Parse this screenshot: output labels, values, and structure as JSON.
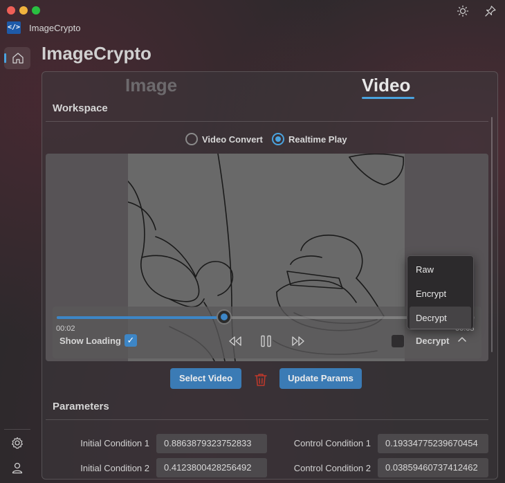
{
  "app": {
    "name": "ImageCrypto",
    "logo_text": "</>"
  },
  "page": {
    "title": "ImageCrypto"
  },
  "tabs": [
    {
      "label": "Image",
      "active": false
    },
    {
      "label": "Video",
      "active": true
    }
  ],
  "workspace": {
    "title": "Workspace",
    "modes": [
      {
        "label": "Video Convert",
        "checked": false
      },
      {
        "label": "Realtime Play",
        "checked": true
      }
    ]
  },
  "player": {
    "current_time": "00:02",
    "duration": "00:05",
    "progress": 0.4,
    "show_loading_label": "Show Loading",
    "show_loading_checked": true,
    "mode_value": "Decrypt",
    "controls": [
      "rewind-icon",
      "pause-icon",
      "fast-forward-icon"
    ]
  },
  "mode_menu": {
    "items": [
      "Raw",
      "Encrypt",
      "Decrypt"
    ],
    "selected": "Decrypt"
  },
  "actions": {
    "select_video": "Select Video",
    "update_params": "Update Params"
  },
  "parameters": {
    "title": "Parameters",
    "fields": [
      {
        "label": "Initial Condition 1",
        "value": "0.8863879323752833"
      },
      {
        "label": "Control Condition 1",
        "value": "0.19334775239670454"
      },
      {
        "label": "Initial Condition 2",
        "value": "0.4123800428256492"
      },
      {
        "label": "Control Condition 2",
        "value": "0.03859460737412462"
      }
    ]
  },
  "colors": {
    "accent": "#3b7bb5",
    "highlight": "#4aa3df",
    "danger": "#c0392b"
  }
}
